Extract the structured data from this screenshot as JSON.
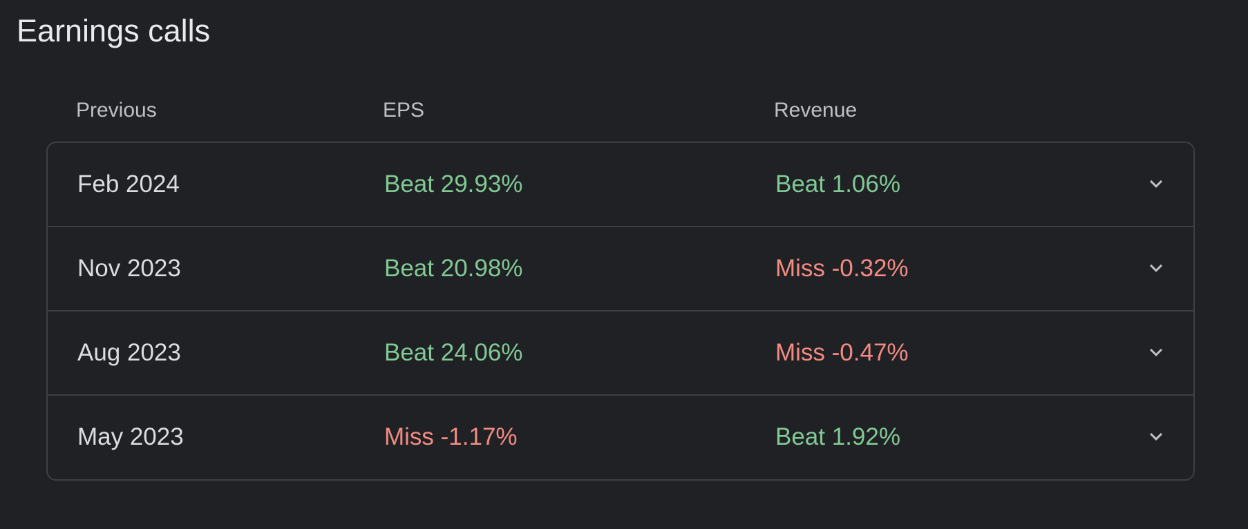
{
  "section": {
    "title": "Earnings calls"
  },
  "columns": {
    "previous": "Previous",
    "eps": "EPS",
    "revenue": "Revenue"
  },
  "colors": {
    "beat": "#81c995",
    "miss": "#f28b82"
  },
  "rows": [
    {
      "date": "Feb 2024",
      "eps": "Beat 29.93%",
      "eps_status": "beat",
      "revenue": "Beat 1.06%",
      "revenue_status": "beat",
      "expand_icon": "chevron-down-icon"
    },
    {
      "date": "Nov 2023",
      "eps": "Beat 20.98%",
      "eps_status": "beat",
      "revenue": "Miss -0.32%",
      "revenue_status": "miss",
      "expand_icon": "chevron-down-icon"
    },
    {
      "date": "Aug 2023",
      "eps": "Beat 24.06%",
      "eps_status": "beat",
      "revenue": "Miss -0.47%",
      "revenue_status": "miss",
      "expand_icon": "chevron-down-icon"
    },
    {
      "date": "May 2023",
      "eps": "Miss -1.17%",
      "eps_status": "miss",
      "revenue": "Beat 1.92%",
      "revenue_status": "beat",
      "expand_icon": "chevron-down-icon"
    }
  ]
}
